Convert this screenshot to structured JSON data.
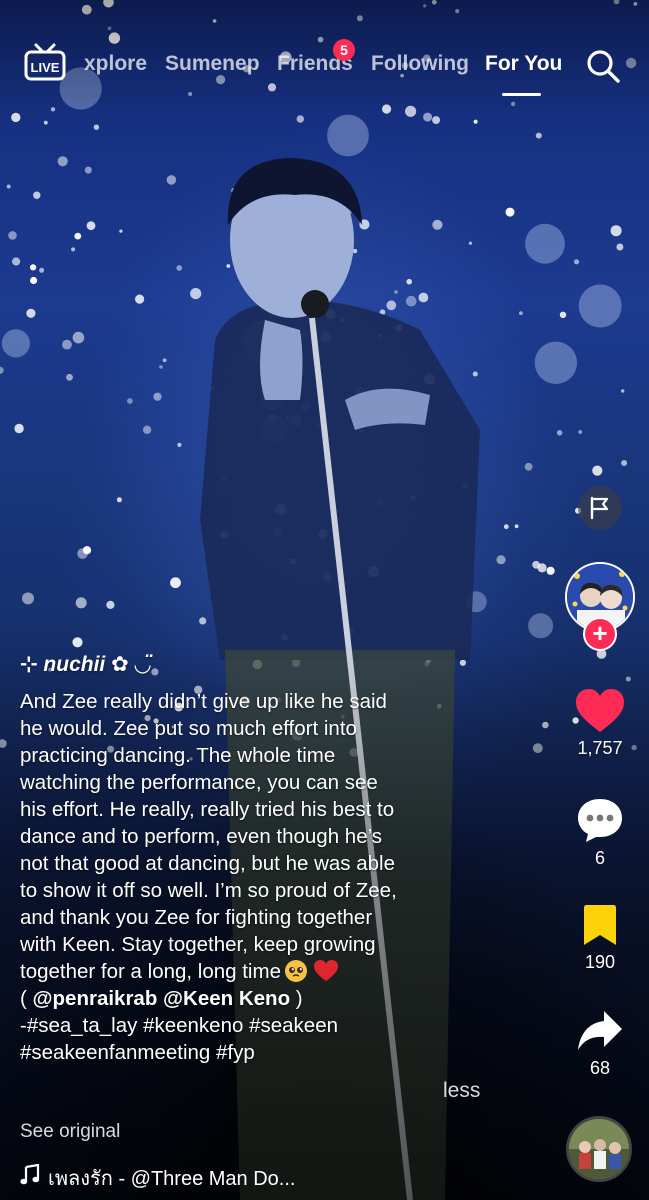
{
  "top_nav": {
    "live_label": "LIVE",
    "tabs": [
      {
        "label": "xplore"
      },
      {
        "label": "Sumenep"
      },
      {
        "label": "Friends"
      },
      {
        "label": "Following"
      },
      {
        "label": "For You"
      }
    ],
    "active_tab": "For You",
    "friends_badge": "5"
  },
  "rail": {
    "like_count": "1,757",
    "comment_count": "6",
    "save_count": "190",
    "share_count": "68"
  },
  "post": {
    "username": "⊹ nuchii ✿ ◡̈",
    "caption_lines": [
      "And Zee really didn’t give up like he said",
      "he would. Zee put so much effort into",
      "practicing dancing. The whole time",
      "watching the performance, you can see",
      "his effort. He really, really tried his best to",
      "dance and to perform, even though he’s",
      "not that good at dancing, but he was able",
      "to show it off so well. I’m so proud of Zee,",
      "and thank you Zee for fighting together",
      "with Keen. Stay together, keep growing",
      "together for a long, long time"
    ],
    "mentions_open": "( ",
    "mentions": "@penraikrab @Keen Keno",
    "mentions_close": " )",
    "hashtags_line1": "-#sea_ta_lay #keenkeno #seakeen",
    "hashtags_line2": "#seakeenfanmeeting  #fyp",
    "less_label": "less",
    "see_original_label": "See original",
    "music_title": "เพลงรัก - @Three Man Do..."
  },
  "colors": {
    "accent": "#fe2c55",
    "save_yellow": "#fcd308",
    "heart_red": "#fe2c55"
  }
}
